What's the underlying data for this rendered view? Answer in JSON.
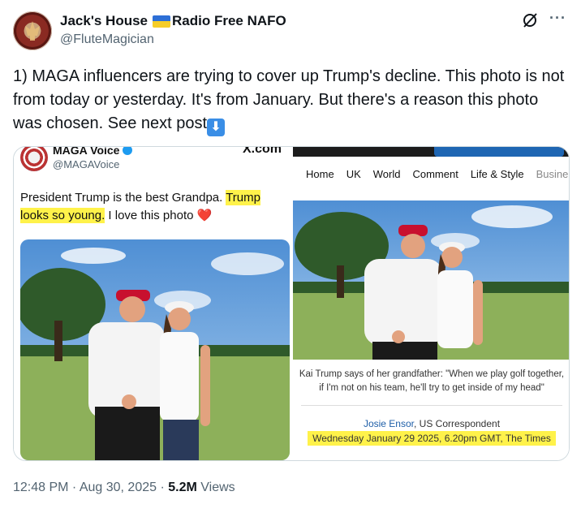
{
  "author": {
    "name_part1": "Jack's House",
    "name_part2": "Radio Free NAFO",
    "handle": "@FluteMagician"
  },
  "tweet": {
    "text": "1) MAGA influencers are trying to cover up Trump's decline. This photo is not from today or yesterday. It's from January. But there's a reason this photo was chosen. See next post",
    "emoji": "⬇"
  },
  "left_screenshot": {
    "account_name": "MAGA Voice",
    "account_handle": "@MAGAVoice",
    "site": "X.com",
    "text_before": "President Trump is the best Grandpa. ",
    "text_highlighted": "Trump looks so young.",
    "text_after": " I love this photo ",
    "heart": "❤️"
  },
  "right_screenshot": {
    "nav": [
      "Home",
      "UK",
      "World",
      "Comment",
      "Life & Style",
      "Busine"
    ],
    "caption": "Kai Trump says of her grandfather: \"When we play golf together, if I'm not on his team, he'll try to get inside of my head\"",
    "author": "Josie Ensor",
    "role": ", US Correspondent",
    "dateline": "Wednesday January 29 2025, 6.20pm GMT, The Times"
  },
  "footer": {
    "time": "12:48 PM · Aug 30, 2025 · ",
    "views_count": "5.2M",
    "views_label": " Views"
  }
}
